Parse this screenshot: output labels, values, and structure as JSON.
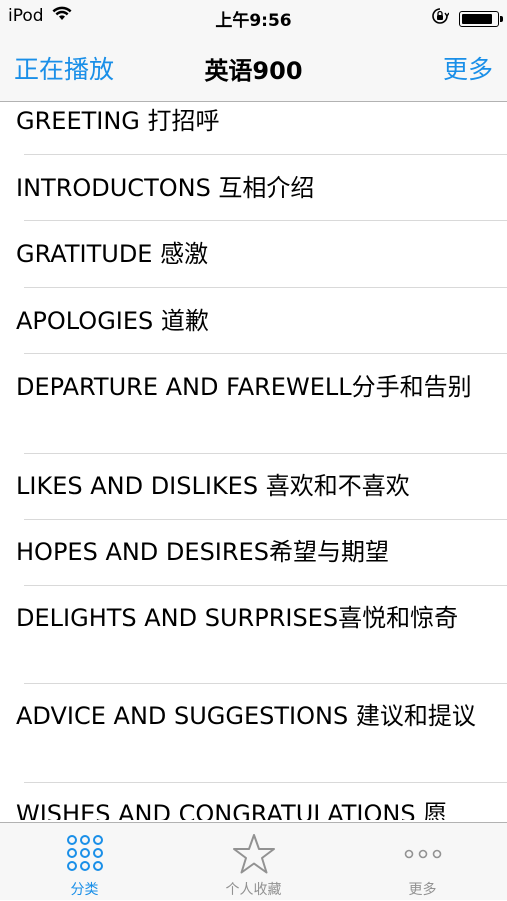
{
  "status_bar": {
    "carrier": "iPod",
    "time": "上午9:56",
    "battery_level": 0.9
  },
  "nav": {
    "left": "正在播放",
    "title": "英语900",
    "right": "更多"
  },
  "list": {
    "items": [
      "GREETING 打招呼",
      "INTRODUCTONS 互相介绍",
      "GRATITUDE 感激",
      "APOLOGIES 道歉",
      "DEPARTURE AND FAREWELL分手和告别",
      "LIKES AND DISLIKES 喜欢和不喜欢",
      "HOPES AND DESIRES希望与期望",
      "DELIGHTS AND SURPRISES喜悦和惊奇",
      "ADVICE AND SUGGESTIONS 建议和提议",
      "WISHES AND CONGRATULATIONS 愿"
    ]
  },
  "tabs": [
    {
      "label": "分类",
      "icon": "grid-dots-icon",
      "active": true
    },
    {
      "label": "个人收藏",
      "icon": "star-icon",
      "active": false
    },
    {
      "label": "更多",
      "icon": "more-dots-icon",
      "active": false
    }
  ],
  "colors": {
    "accent": "#1a8fe8",
    "inactive": "#929292"
  }
}
